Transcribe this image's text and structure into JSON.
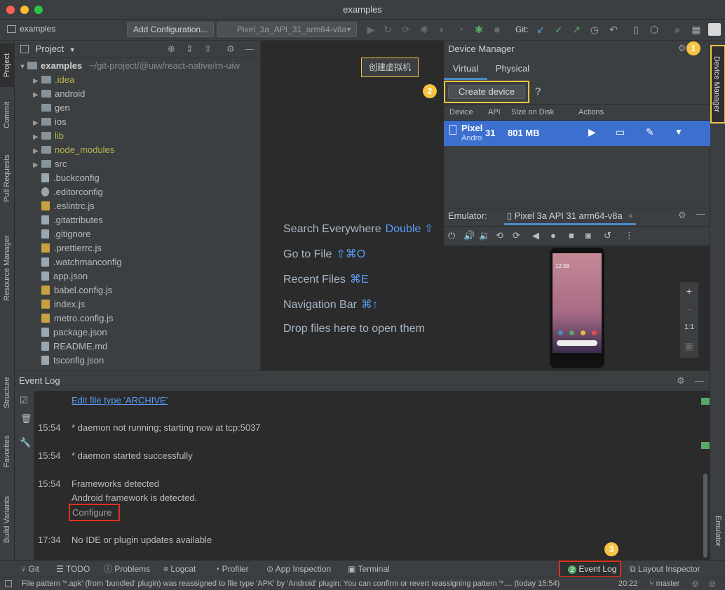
{
  "window": {
    "title": "examples"
  },
  "toolbar": {
    "project_name": "examples",
    "add_config_label": "Add Configuration...",
    "device_select_label": "Pixel_3a_API_31_arm64-v8a",
    "git_label": "Git:"
  },
  "left_stripe": {
    "project": "Project",
    "commit": "Commit",
    "pull_requests": "Pull Requests",
    "resource_manager": "Resource Manager",
    "structure": "Structure",
    "favorites": "Favorites",
    "build_variants": "Build Variants"
  },
  "right_stripe": {
    "device_manager": "Device Manager",
    "emulator": "Emulator"
  },
  "project": {
    "title": "Project",
    "root_name": "examples",
    "root_path": "~/git-project/@uiw/react-native/rn-uiw",
    "items": [
      {
        "label": ".idea",
        "kind": "folder",
        "expandable": true,
        "color": "#b9b34f"
      },
      {
        "label": "android",
        "kind": "folder",
        "expandable": true,
        "color": "#bbbbbb"
      },
      {
        "label": "gen",
        "kind": "folder",
        "expandable": false,
        "color": "#bbbbbb"
      },
      {
        "label": "ios",
        "kind": "folder",
        "expandable": true,
        "color": "#bbbbbb"
      },
      {
        "label": "lib",
        "kind": "folder",
        "expandable": true,
        "color": "#b9b34f"
      },
      {
        "label": "node_modules",
        "kind": "folder",
        "expandable": true,
        "color": "#b9b34f"
      },
      {
        "label": "src",
        "kind": "folder",
        "expandable": true,
        "color": "#bbbbbb"
      },
      {
        "label": ".buckconfig",
        "kind": "file",
        "color": "#bbbbbb"
      },
      {
        "label": ".editorconfig",
        "kind": "gear",
        "color": "#bbbbbb"
      },
      {
        "label": ".eslintrc.js",
        "kind": "js",
        "color": "#bbbbbb"
      },
      {
        "label": ".gitattributes",
        "kind": "file",
        "color": "#bbbbbb"
      },
      {
        "label": ".gitignore",
        "kind": "file",
        "color": "#bbbbbb"
      },
      {
        "label": ".prettierrc.js",
        "kind": "js",
        "color": "#bbbbbb"
      },
      {
        "label": ".watchmanconfig",
        "kind": "file",
        "color": "#bbbbbb"
      },
      {
        "label": "app.json",
        "kind": "file",
        "color": "#bbbbbb"
      },
      {
        "label": "babel.config.js",
        "kind": "js",
        "color": "#bbbbbb"
      },
      {
        "label": "index.js",
        "kind": "js",
        "color": "#bbbbbb"
      },
      {
        "label": "metro.config.js",
        "kind": "js",
        "color": "#bbbbbb"
      },
      {
        "label": "package.json",
        "kind": "file",
        "color": "#bbbbbb"
      },
      {
        "label": "README.md",
        "kind": "file",
        "color": "#bbbbbb"
      },
      {
        "label": "tsconfig.json",
        "kind": "file",
        "color": "#bbbbbb"
      }
    ]
  },
  "editor": {
    "hints": [
      {
        "label": "Search Everywhere",
        "key": "Double ⇧"
      },
      {
        "label": "Go to File",
        "key": "⇧⌘O"
      },
      {
        "label": "Recent Files",
        "key": "⌘E"
      },
      {
        "label": "Navigation Bar",
        "key": "⌘↑"
      },
      {
        "label": "Drop files here to open them",
        "key": ""
      }
    ],
    "tooltip": "创建虚拟机"
  },
  "device_manager": {
    "title": "Device Manager",
    "tabs": [
      "Virtual",
      "Physical"
    ],
    "create_label": "Create device",
    "help_label": "?",
    "columns": [
      "Device",
      "API",
      "Size on Disk",
      "Actions"
    ],
    "device": {
      "name": "Pixel",
      "sub": "Andro",
      "api": "31",
      "size": "801 MB"
    }
  },
  "emulator": {
    "label": "Emulator:",
    "tab_label": "Pixel 3a API 31 arm64-v8a",
    "phone_time": "12:08",
    "zoom_in": "+",
    "zoom_out": "−",
    "ratio": "1:1"
  },
  "event_log": {
    "title": "Event Log",
    "link_top": "Edit file type 'ARCHIVE'",
    "entries": [
      {
        "time": "15:54",
        "text": "* daemon not running; starting now at tcp:5037"
      },
      {
        "time": "15:54",
        "text": "* daemon started successfully"
      },
      {
        "time": "15:54",
        "text": "Frameworks detected"
      },
      {
        "time": "",
        "text": "Android framework is detected."
      },
      {
        "time": "17:34",
        "text": "No IDE or plugin updates available"
      }
    ],
    "configure_label": "Configure"
  },
  "bottom_tabs": [
    "Git",
    "TODO",
    "Problems",
    "Logcat",
    "Profiler",
    "App Inspection",
    "Terminal"
  ],
  "event_log_tab": {
    "count": "2",
    "label": "Event Log"
  },
  "layout_inspector": "Layout Inspector",
  "status": {
    "message": "File pattern '*.apk' (from 'bundled' plugin) was reassigned to file type 'APK' by 'Android' plugin: You can confirm or revert reassigning pattern '*.... (today 15:54)",
    "time": "20:22",
    "branch": "master"
  },
  "callouts": [
    "1",
    "2",
    "3"
  ],
  "colors": {
    "accent": "#3d7bd9",
    "highlight": "#f6c342",
    "red": "#e0301e"
  }
}
